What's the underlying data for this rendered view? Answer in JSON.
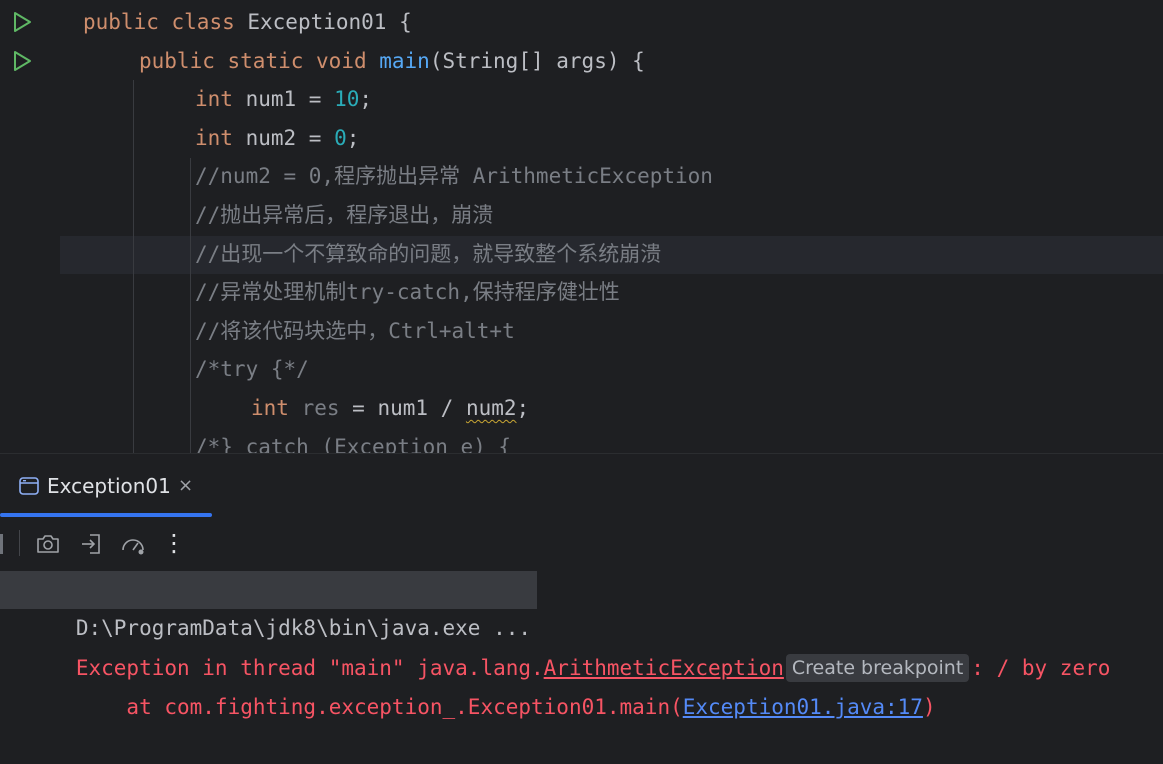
{
  "editor": {
    "lines": [
      {
        "indent": "",
        "tokens": [
          [
            "kw",
            "public "
          ],
          [
            "kw",
            "class "
          ],
          [
            "plain",
            "Exception01 {"
          ]
        ]
      },
      {
        "indent": "    ",
        "tokens": [
          [
            "kw",
            "public "
          ],
          [
            "kw",
            "static "
          ],
          [
            "kw",
            "void "
          ],
          [
            "fn",
            "main"
          ],
          [
            "plain",
            "(String[] args) {"
          ]
        ]
      },
      {
        "indent": "        ",
        "tokens": [
          [
            "kw",
            "int "
          ],
          [
            "plain",
            "num1 = "
          ],
          [
            "num",
            "10"
          ],
          [
            "plain",
            ";"
          ]
        ]
      },
      {
        "indent": "        ",
        "tokens": [
          [
            "kw",
            "int "
          ],
          [
            "plain",
            "num2 = "
          ],
          [
            "num",
            "0"
          ],
          [
            "plain",
            ";"
          ]
        ]
      },
      {
        "indent": "        ",
        "tokens": [
          [
            "cm",
            "//num2 = 0,程序抛出异常 ArithmeticException"
          ]
        ]
      },
      {
        "indent": "        ",
        "tokens": [
          [
            "cm",
            "//抛出异常后，程序退出，崩溃"
          ]
        ]
      },
      {
        "indent": "        ",
        "tokens": [
          [
            "cm",
            "//出现一个不算致命的问题，就导致整个系统崩溃"
          ]
        ]
      },
      {
        "indent": "        ",
        "tokens": [
          [
            "cm",
            "//异常处理机制try-catch,保持程序健壮性"
          ]
        ]
      },
      {
        "indent": "        ",
        "tokens": [
          [
            "cm",
            "//将该代码块选中，Ctrl+alt+t"
          ]
        ]
      },
      {
        "indent": "        ",
        "tokens": [
          [
            "cm",
            "/*try {*/"
          ]
        ]
      },
      {
        "indent": "            ",
        "tokens": [
          [
            "kw",
            "int "
          ],
          [
            "unused",
            "res"
          ],
          [
            "plain",
            " = num1 / "
          ],
          [
            "squiggle",
            "num2"
          ],
          [
            "plain",
            ";"
          ]
        ]
      },
      {
        "indent": "        ",
        "tokens": [
          [
            "cm",
            "/*} catch (Exception e) {"
          ]
        ]
      }
    ]
  },
  "run_tab": {
    "label": "Exception01",
    "close": "×"
  },
  "toolbar": {
    "buttons": [
      "camera-icon",
      "login-icon",
      "speedometer-icon",
      "more-vertical-icon"
    ],
    "more_label": "⋮"
  },
  "console": {
    "command": "D:\\ProgramData\\jdk8\\bin\\java.exe ...",
    "error_prefix": "Exception in thread \"main\" java.lang.",
    "error_class": "ArithmeticException",
    "breakpoint_chip": "Create breakpoint",
    "error_suffix": ": / by zero",
    "stack_prefix": "    at com.fighting.exception_.Exception01.main(",
    "stack_link": "Exception01.java:17",
    "stack_suffix": ")"
  },
  "colors": {
    "background": "#1e1f22",
    "keyword": "#cf8e6d",
    "function": "#56a8f5",
    "number": "#2aacb8",
    "comment": "#7a7e85",
    "error": "#f75464",
    "link": "#548af7",
    "accent": "#3574f0"
  }
}
